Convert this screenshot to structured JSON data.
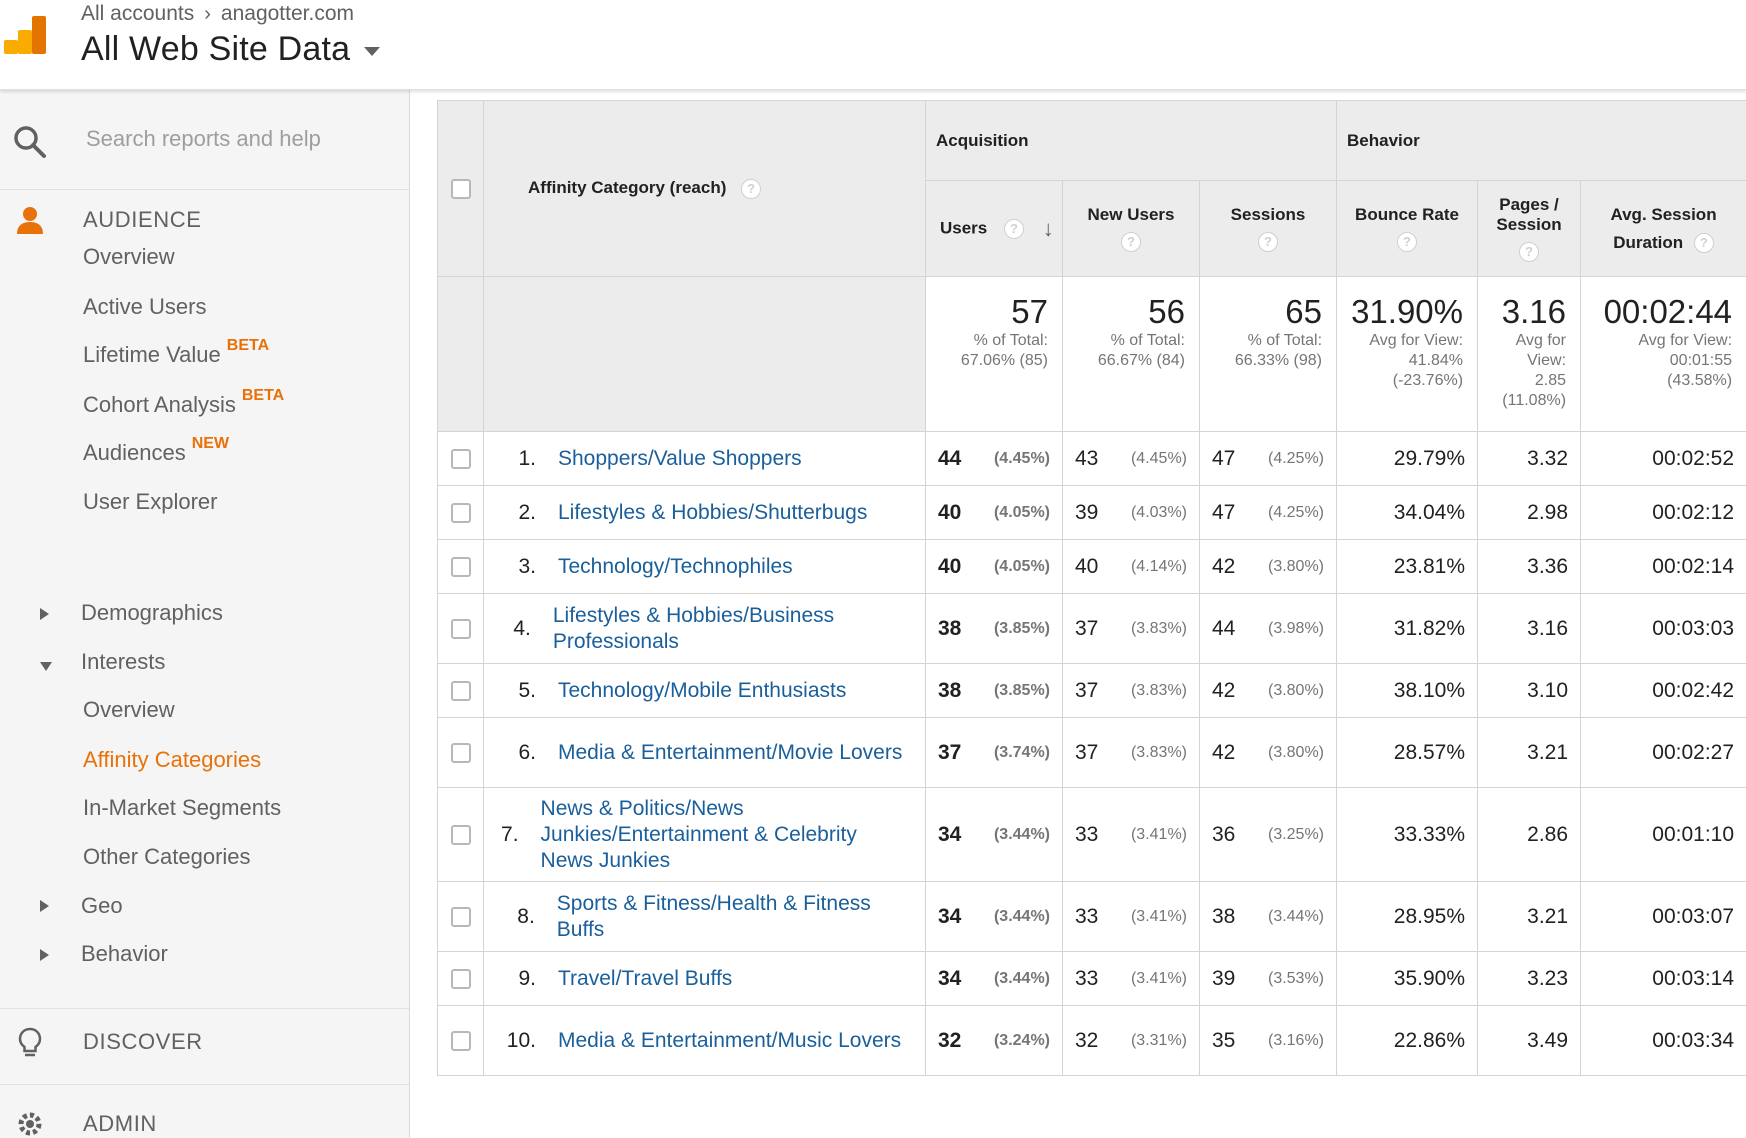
{
  "header": {
    "breadcrumb": [
      "All accounts",
      "anagotter.com"
    ],
    "view_title": "All Web Site Data"
  },
  "sidebar": {
    "search_placeholder": "Search reports and help",
    "audience_label": "AUDIENCE",
    "items": {
      "overview": "Overview",
      "active_users": "Active Users",
      "lifetime_value": "Lifetime Value",
      "lifetime_value_badge": "BETA",
      "cohort_analysis": "Cohort Analysis",
      "cohort_analysis_badge": "BETA",
      "audiences": "Audiences",
      "audiences_badge": "NEW",
      "user_explorer": "User Explorer",
      "demographics": "Demographics",
      "interests": "Interests",
      "interests_overview": "Overview",
      "affinity_categories": "Affinity Categories",
      "in_market_segments": "In-Market Segments",
      "other_categories": "Other Categories",
      "geo": "Geo",
      "behavior": "Behavior"
    },
    "discover_label": "DISCOVER",
    "admin_label": "ADMIN"
  },
  "table": {
    "dimension_header": "Affinity Category (reach)",
    "groups": {
      "acquisition": "Acquisition",
      "behavior": "Behavior"
    },
    "columns": {
      "users": "Users",
      "new_users": "New Users",
      "sessions": "Sessions",
      "bounce_rate": "Bounce Rate",
      "pages_session": "Pages / Session",
      "avg_duration": "Avg. Session Duration"
    },
    "summary": {
      "users": {
        "value": "57",
        "l1": "% of Total:",
        "l2": "67.06% (85)"
      },
      "new_users": {
        "value": "56",
        "l1": "% of Total:",
        "l2": "66.67% (84)"
      },
      "sessions": {
        "value": "65",
        "l1": "% of Total:",
        "l2": "66.33% (98)"
      },
      "bounce_rate": {
        "value": "31.90%",
        "l1": "Avg for View:",
        "l2": "41.84%",
        "l3": "(-23.76%)"
      },
      "pages_session": {
        "value": "3.16",
        "l1": "Avg for",
        "l2": "View:",
        "l3": "2.85",
        "l4": "(11.08%)"
      },
      "avg_duration": {
        "value": "00:02:44",
        "l1": "Avg for View:",
        "l2": "00:01:55",
        "l3": "(43.58%)"
      }
    },
    "rows": [
      {
        "idx": "1.",
        "name": "Shoppers/Value Shoppers",
        "users": "44",
        "users_pct": "(4.45%)",
        "new_users": "43",
        "new_users_pct": "(4.45%)",
        "sessions": "47",
        "sessions_pct": "(4.25%)",
        "bounce": "29.79%",
        "pages": "3.32",
        "duration": "00:02:52"
      },
      {
        "idx": "2.",
        "name": "Lifestyles & Hobbies/Shutterbugs",
        "users": "40",
        "users_pct": "(4.05%)",
        "new_users": "39",
        "new_users_pct": "(4.03%)",
        "sessions": "47",
        "sessions_pct": "(4.25%)",
        "bounce": "34.04%",
        "pages": "2.98",
        "duration": "00:02:12"
      },
      {
        "idx": "3.",
        "name": "Technology/Technophiles",
        "users": "40",
        "users_pct": "(4.05%)",
        "new_users": "40",
        "new_users_pct": "(4.14%)",
        "sessions": "42",
        "sessions_pct": "(3.80%)",
        "bounce": "23.81%",
        "pages": "3.36",
        "duration": "00:02:14"
      },
      {
        "idx": "4.",
        "name": "Lifestyles & Hobbies/Business Professionals",
        "users": "38",
        "users_pct": "(3.85%)",
        "new_users": "37",
        "new_users_pct": "(3.83%)",
        "sessions": "44",
        "sessions_pct": "(3.98%)",
        "bounce": "31.82%",
        "pages": "3.16",
        "duration": "00:03:03"
      },
      {
        "idx": "5.",
        "name": "Technology/Mobile Enthusiasts",
        "users": "38",
        "users_pct": "(3.85%)",
        "new_users": "37",
        "new_users_pct": "(3.83%)",
        "sessions": "42",
        "sessions_pct": "(3.80%)",
        "bounce": "38.10%",
        "pages": "3.10",
        "duration": "00:02:42"
      },
      {
        "idx": "6.",
        "name": "Media & Entertainment/Movie Lovers",
        "users": "37",
        "users_pct": "(3.74%)",
        "new_users": "37",
        "new_users_pct": "(3.83%)",
        "sessions": "42",
        "sessions_pct": "(3.80%)",
        "bounce": "28.57%",
        "pages": "3.21",
        "duration": "00:02:27"
      },
      {
        "idx": "7.",
        "name": "News & Politics/News Junkies/Entertainment & Celebrity News Junkies",
        "users": "34",
        "users_pct": "(3.44%)",
        "new_users": "33",
        "new_users_pct": "(3.41%)",
        "sessions": "36",
        "sessions_pct": "(3.25%)",
        "bounce": "33.33%",
        "pages": "2.86",
        "duration": "00:01:10"
      },
      {
        "idx": "8.",
        "name": "Sports & Fitness/Health & Fitness Buffs",
        "users": "34",
        "users_pct": "(3.44%)",
        "new_users": "33",
        "new_users_pct": "(3.41%)",
        "sessions": "38",
        "sessions_pct": "(3.44%)",
        "bounce": "28.95%",
        "pages": "3.21",
        "duration": "00:03:07"
      },
      {
        "idx": "9.",
        "name": "Travel/Travel Buffs",
        "users": "34",
        "users_pct": "(3.44%)",
        "new_users": "33",
        "new_users_pct": "(3.41%)",
        "sessions": "39",
        "sessions_pct": "(3.53%)",
        "bounce": "35.90%",
        "pages": "3.23",
        "duration": "00:03:14"
      },
      {
        "idx": "10.",
        "name": "Media & Entertainment/Music Lovers",
        "users": "32",
        "users_pct": "(3.24%)",
        "new_users": "32",
        "new_users_pct": "(3.31%)",
        "sessions": "35",
        "sessions_pct": "(3.16%)",
        "bounce": "22.86%",
        "pages": "3.49",
        "duration": "00:03:34"
      }
    ]
  },
  "colors": {
    "accent": "#e8710a",
    "link": "#1a5f9b",
    "header_bg": "#ececec"
  }
}
